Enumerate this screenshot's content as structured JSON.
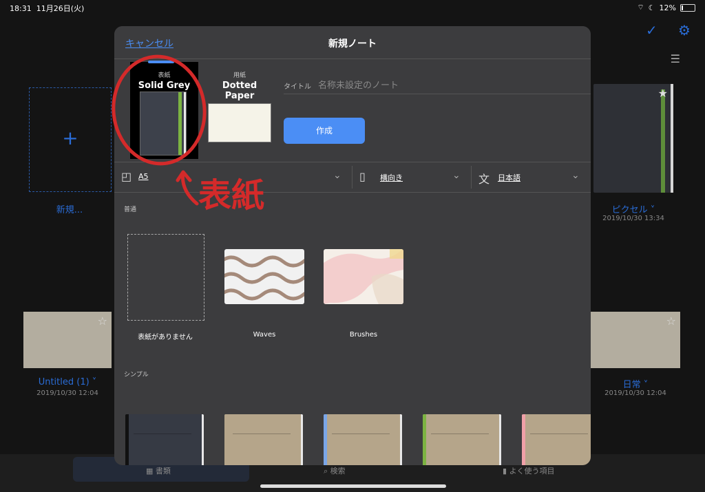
{
  "status_bar": {
    "time": "18:31",
    "date": "11月26日(火)",
    "battery": "12%"
  },
  "background": {
    "header_title_partial": "表紙",
    "new_note_label": "新規...",
    "notebooks": [
      {
        "name": "ピクセル ˅",
        "date": "2019/10/30 13:34"
      },
      {
        "name": "Untitled (1) ˅",
        "date": "2019/10/30 12:04"
      },
      {
        "name": "日常 ˅",
        "date": "2019/10/30 12:04"
      }
    ],
    "tabs": [
      "書類",
      "検索",
      "よく使う項目"
    ]
  },
  "modal": {
    "cancel_label": "キャンセル",
    "title": "新規ノート",
    "cover": {
      "caption": "表紙",
      "name": "Solid Grey"
    },
    "paper": {
      "caption": "用紙",
      "name": "Dotted Paper"
    },
    "title_field": {
      "label": "タイトル",
      "placeholder": "名称未設定のノート",
      "value": ""
    },
    "create_label": "作成",
    "options": {
      "size": "A5",
      "orientation": "横向き",
      "language": "日本語"
    },
    "sections": {
      "normal": "普通",
      "simple": "シンプル"
    },
    "cover_options": [
      {
        "name": "表紙がありません"
      },
      {
        "name": "Waves"
      },
      {
        "name": "Brushes"
      }
    ],
    "simple_covers": [
      {
        "color": "#363a44",
        "spine": "#111111"
      },
      {
        "color": "#b5a58a",
        "spine": "#b5a58a"
      },
      {
        "color": "#b5a58a",
        "spine": "#7aa6e8"
      },
      {
        "color": "#b5a58a",
        "spine": "#7cb342"
      },
      {
        "color": "#b5a58a",
        "spine": "#f0a0a8"
      }
    ]
  },
  "annotation": {
    "text": "表紙",
    "color": "#d42a2a"
  },
  "colors": {
    "accent": "#4b8ef5",
    "modal_bg": "#3c3c3e",
    "page_bg": "#141414"
  }
}
